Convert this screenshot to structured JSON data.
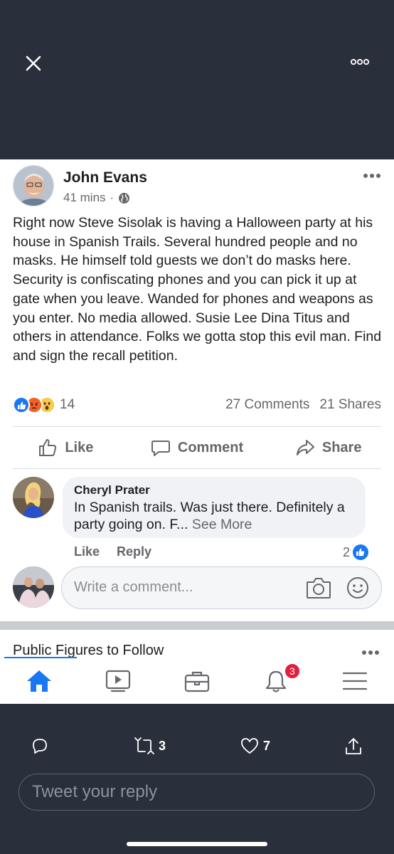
{
  "post": {
    "author": "John Evans",
    "time": "41 mins",
    "separator": "·",
    "text": "Right now Steve Sisolak is having a Halloween party at his house in Spanish Trails. Several hundred people and no masks. He himself told guests we don’t do masks here. Security is confiscating phones and you can pick it up at gate when you leave. Wanded for phones and weapons as you enter. No media allowed. Susie Lee Dina Titus and others in attendance. Folks we gotta stop this evil man. Find and sign the recall petition.",
    "reaction_count": "14",
    "comments": "27 Comments",
    "shares": "21 Shares"
  },
  "actions": {
    "like": "Like",
    "comment": "Comment",
    "share": "Share"
  },
  "comment": {
    "name": "Cheryl Prater",
    "text": "In Spanish trails.  Was just there. Definitely a party going on. F...",
    "see_more": "See More",
    "like": "Like",
    "reply": "Reply",
    "likes": "2"
  },
  "composer": {
    "placeholder": "Write a comment..."
  },
  "section": {
    "title": "Public Figures to Follow"
  },
  "tabbar": {
    "notifications_badge": "3"
  },
  "twitter": {
    "retweets": "3",
    "likes": "7",
    "reply_placeholder": "Tweet your reply"
  },
  "colors": {
    "dark_bg": "#2a303b",
    "fb_blue": "#1877f2",
    "badge_red": "#e41e3f"
  }
}
